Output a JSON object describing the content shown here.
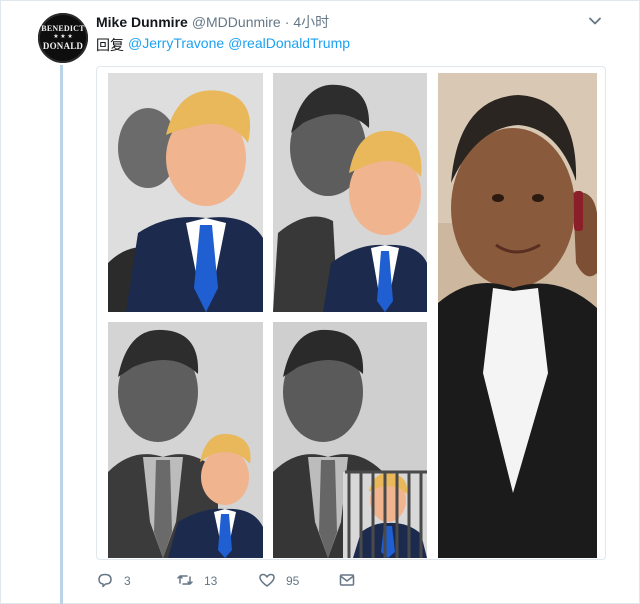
{
  "tweet": {
    "author": {
      "display_name": "Mike Dunmire",
      "handle": "@MDDunmire",
      "separator": "·",
      "time": "4小时",
      "avatar": {
        "top_text": "BENEDICT",
        "bottom_text": "DONALD"
      }
    },
    "reply": {
      "prefix": "回复",
      "mentions": [
        "@JerryTravone",
        "@realDonaldTrump"
      ]
    },
    "menu_icon": "chevron-down-icon",
    "media_icons": [
      "photo",
      "photo",
      "photo",
      "photo",
      "photo"
    ],
    "actions": {
      "reply": {
        "icon": "reply-icon",
        "count": "3"
      },
      "retweet": {
        "icon": "retweet-icon",
        "count": "13"
      },
      "like": {
        "icon": "heart-icon",
        "count": "95"
      },
      "dm": {
        "icon": "envelope-icon"
      }
    },
    "colors": {
      "link": "#1da1f2",
      "secondary_text": "#657786",
      "thread_line": "#b8d4e6"
    }
  }
}
